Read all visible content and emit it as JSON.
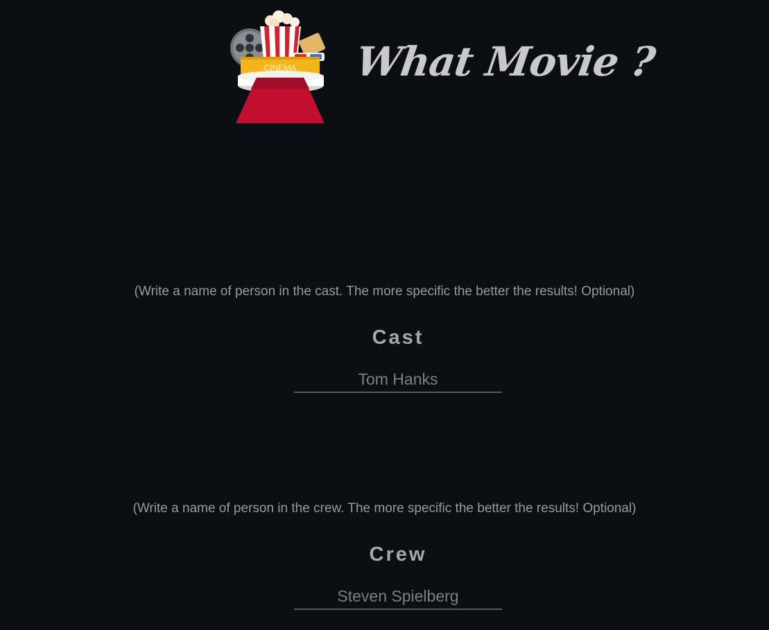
{
  "brand": {
    "title": "What Movie ?",
    "logo_text": "CINEMA",
    "logo_icon": "cinema-popcorn-red-carpet-icon"
  },
  "cast": {
    "hint": "(Write a name of person in the cast. The more specific the better the results! Optional)",
    "label": "Cast",
    "placeholder": "Tom Hanks"
  },
  "crew": {
    "hint": "(Write a name of person in the crew. The more specific the better the results! Optional)",
    "label": "Crew",
    "placeholder": "Steven Spielberg"
  },
  "colors": {
    "background": "#0b0f14",
    "text": "#b7b7b7",
    "accent_red": "#c8102e",
    "accent_yellow": "#f6b800"
  }
}
